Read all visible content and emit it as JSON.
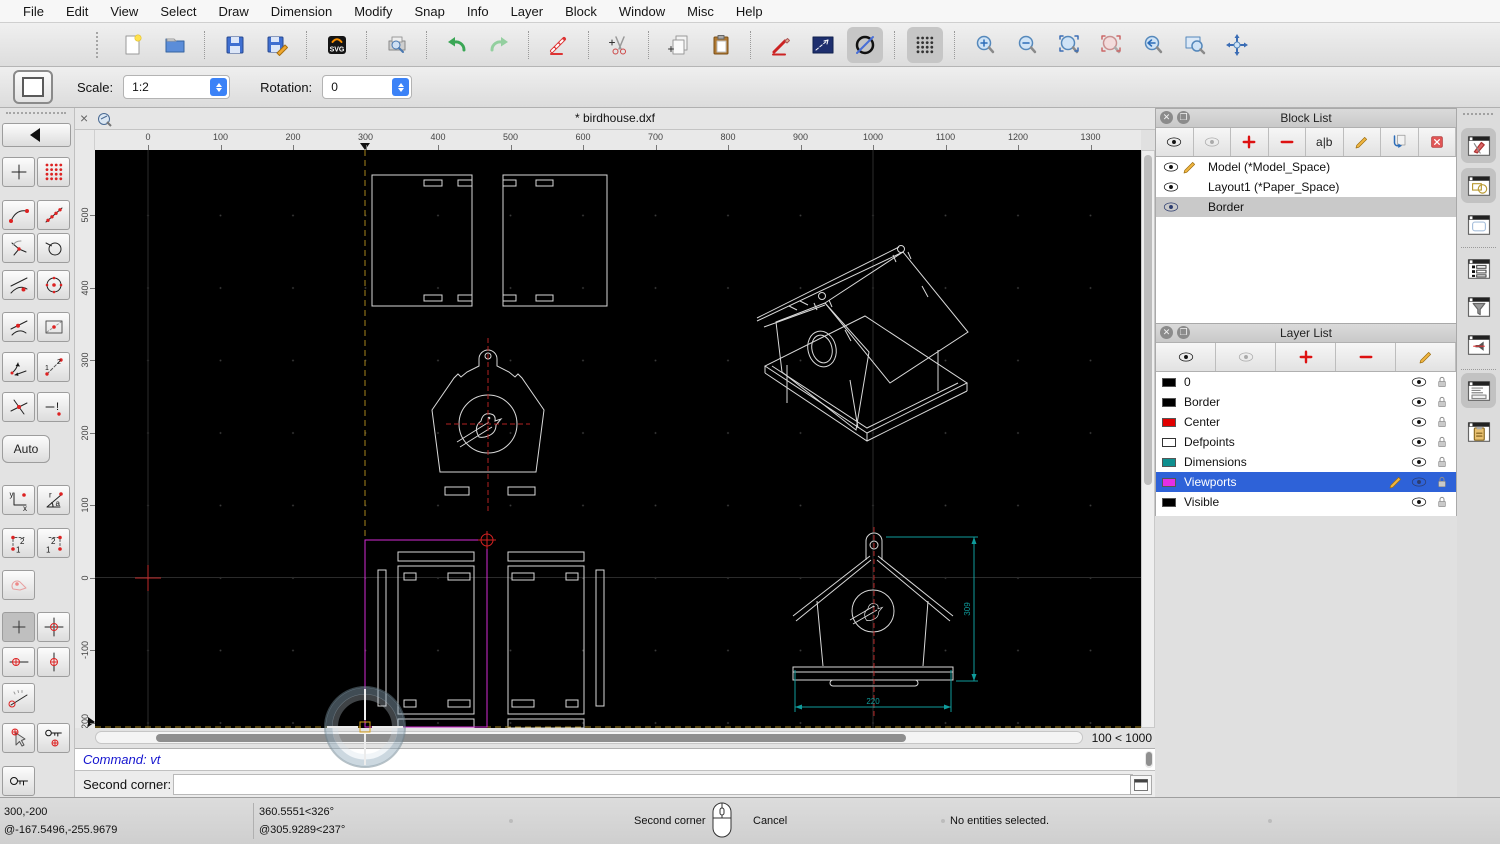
{
  "menu_bar": {
    "items": [
      "File",
      "Edit",
      "View",
      "Select",
      "Draw",
      "Dimension",
      "Modify",
      "Snap",
      "Info",
      "Layer",
      "Block",
      "Window",
      "Misc",
      "Help"
    ]
  },
  "toolbar": {
    "buttons": [
      {
        "name": "new-document-icon"
      },
      {
        "name": "open-file-icon",
        "sep": true
      },
      {
        "name": "save-icon"
      },
      {
        "name": "save-as-icon",
        "sep": true
      },
      {
        "name": "export-svg-icon",
        "sep": true
      },
      {
        "name": "print-preview-icon",
        "sep": true
      },
      {
        "name": "undo-icon"
      },
      {
        "name": "redo-icon",
        "sep": true
      },
      {
        "name": "delete-icon",
        "sep": true
      },
      {
        "name": "cut-icon",
        "sep": true
      },
      {
        "name": "copy-icon"
      },
      {
        "name": "paste-icon",
        "sep": true
      },
      {
        "name": "pen-attributes-icon"
      },
      {
        "name": "line-attributes-icon"
      },
      {
        "name": "draft-mode-icon",
        "pressed": true,
        "sep": true
      },
      {
        "name": "grid-toggle-icon",
        "pressed": true,
        "sep": true
      },
      {
        "name": "zoom-in-icon"
      },
      {
        "name": "zoom-out-icon"
      },
      {
        "name": "zoom-auto-icon"
      },
      {
        "name": "zoom-previous-icon"
      },
      {
        "name": "zoom-back-icon"
      },
      {
        "name": "zoom-window-icon"
      },
      {
        "name": "zoom-pan-icon"
      }
    ]
  },
  "options_bar": {
    "scale_label": "Scale:",
    "scale_value": "1:2",
    "rotation_label": "Rotation:",
    "rotation_value": "0"
  },
  "tab_bar": {
    "close_glyph": "×",
    "title": "* birdhouse.dxf"
  },
  "rulers": {
    "horizontal": [
      "0",
      "100",
      "200",
      "300",
      "400",
      "500",
      "600",
      "700",
      "800",
      "900",
      "1000",
      "1100",
      "1200",
      "1300"
    ],
    "vertical": [
      "500",
      "400",
      "300",
      "200",
      "100",
      "0",
      "-100",
      "-200"
    ]
  },
  "left_toolbar": {
    "auto_label": "Auto",
    "buttons": [
      {
        "name": "back-icon"
      },
      {
        "name": "snap-free-icon"
      },
      {
        "name": "snap-grid-icon"
      },
      {
        "name": "snap-endpoints-icon"
      },
      {
        "name": "snap-on-entity-icon"
      },
      {
        "name": "snap-intersection-icon"
      },
      {
        "name": "snap-on-arc-icon"
      },
      {
        "name": "snap-tangent-icon"
      },
      {
        "name": "snap-center-icon"
      },
      {
        "name": "snap-nearest-icon"
      },
      {
        "name": "snap-reference-icon"
      },
      {
        "name": "restrict-orthogonal-icon"
      },
      {
        "name": "snap-distance-icon"
      },
      {
        "name": "snap-intersection-x-icon"
      },
      {
        "name": "snap-intersection-manual-icon"
      },
      {
        "name": "auto-snap-button"
      },
      {
        "name": "coord-cartesian-icon"
      },
      {
        "name": "coord-polar-icon"
      },
      {
        "name": "corner-first-icon"
      },
      {
        "name": "corner-second-icon"
      },
      {
        "name": "snap-middle-icon"
      },
      {
        "name": "relative-plus-icon",
        "pressed": true
      },
      {
        "name": "target-cross-icon"
      },
      {
        "name": "target-horizontal-icon"
      },
      {
        "name": "target-vertical-icon"
      },
      {
        "name": "angle-indicator-icon"
      },
      {
        "name": "select-target-icon"
      },
      {
        "name": "lock-target-icon"
      },
      {
        "name": "relative-zero-lock-icon"
      }
    ]
  },
  "block_list": {
    "title": "Block List",
    "tools": [
      {
        "name": "show-all-blocks-icon"
      },
      {
        "name": "hide-all-blocks-icon"
      },
      {
        "name": "add-block-icon"
      },
      {
        "name": "remove-block-icon"
      },
      {
        "name": "rename-block-button",
        "label": "a|b"
      },
      {
        "name": "edit-block-icon"
      },
      {
        "name": "insert-block-icon"
      },
      {
        "name": "delete-block-icon"
      }
    ],
    "items": [
      {
        "label": "Model (*Model_Space)",
        "visible": true,
        "editing": true,
        "selected": false
      },
      {
        "label": "Layout1 (*Paper_Space)",
        "visible": true,
        "editing": false,
        "selected": false
      },
      {
        "label": "Border",
        "visible": true,
        "editing": false,
        "selected": true
      }
    ]
  },
  "layer_list": {
    "title": "Layer List",
    "tools": [
      {
        "name": "show-all-layers-icon"
      },
      {
        "name": "hide-all-layers-icon"
      },
      {
        "name": "add-layer-icon"
      },
      {
        "name": "remove-layer-icon"
      },
      {
        "name": "edit-layer-icon"
      }
    ],
    "layers": [
      {
        "name": "0",
        "color": "#000000",
        "visible": true,
        "locked": false,
        "selected": false,
        "editing": false
      },
      {
        "name": "Border",
        "color": "#000000",
        "visible": true,
        "locked": false,
        "selected": false,
        "editing": false
      },
      {
        "name": "Center",
        "color": "#e00000",
        "visible": true,
        "locked": false,
        "selected": false,
        "editing": false
      },
      {
        "name": "Defpoints",
        "color": "#ffffff",
        "visible": true,
        "locked": false,
        "selected": false,
        "editing": false
      },
      {
        "name": "Dimensions",
        "color": "#0e8f8f",
        "visible": true,
        "locked": false,
        "selected": false,
        "editing": false
      },
      {
        "name": "Viewports",
        "color": "#e52ee5",
        "visible": true,
        "locked": false,
        "selected": true,
        "editing": true
      },
      {
        "name": "Visible",
        "color": "#000000",
        "visible": true,
        "locked": false,
        "selected": false,
        "editing": false
      }
    ]
  },
  "dock_strip": {
    "icons": [
      {
        "name": "dock-library-panel-icon",
        "pressed": true
      },
      {
        "name": "dock-shapes-panel-icon",
        "pressed": true
      },
      {
        "name": "dock-blank-panel-icon",
        "pressed": false
      },
      {
        "name": "dock-list-panel-icon",
        "pressed": false
      },
      {
        "name": "dock-filter-panel-icon",
        "pressed": false
      },
      {
        "name": "dock-render-panel-icon",
        "pressed": false
      },
      {
        "name": "dock-command-panel-icon",
        "pressed": true
      },
      {
        "name": "dock-clipboard-panel-icon",
        "pressed": false
      }
    ]
  },
  "scroll": {
    "zoom_indicator": "100 < 1000"
  },
  "command": {
    "history": "Command: vt",
    "prompt_label": "Second corner:",
    "input_value": ""
  },
  "status_bar": {
    "abs_coord": "300,-200",
    "rel_coord": "@-167.5496,-255.9679",
    "abs_polar": "360.5551<326°",
    "rel_polar": "@305.9289<237°",
    "action_hint": "Second corner",
    "cancel_hint": "Cancel",
    "selection_status": "No entities selected."
  },
  "drawing": {
    "dim_height": "309",
    "dim_width": "220",
    "colors": {
      "background": "#000000",
      "entity": "#d9d9d9",
      "centerline_red": "#b22222",
      "dimension_teal": "#0f9b9b",
      "viewport_magenta": "#d42bd4",
      "crosshair_orange": "#a8861c",
      "selection_blue": "#2e62d8"
    }
  }
}
